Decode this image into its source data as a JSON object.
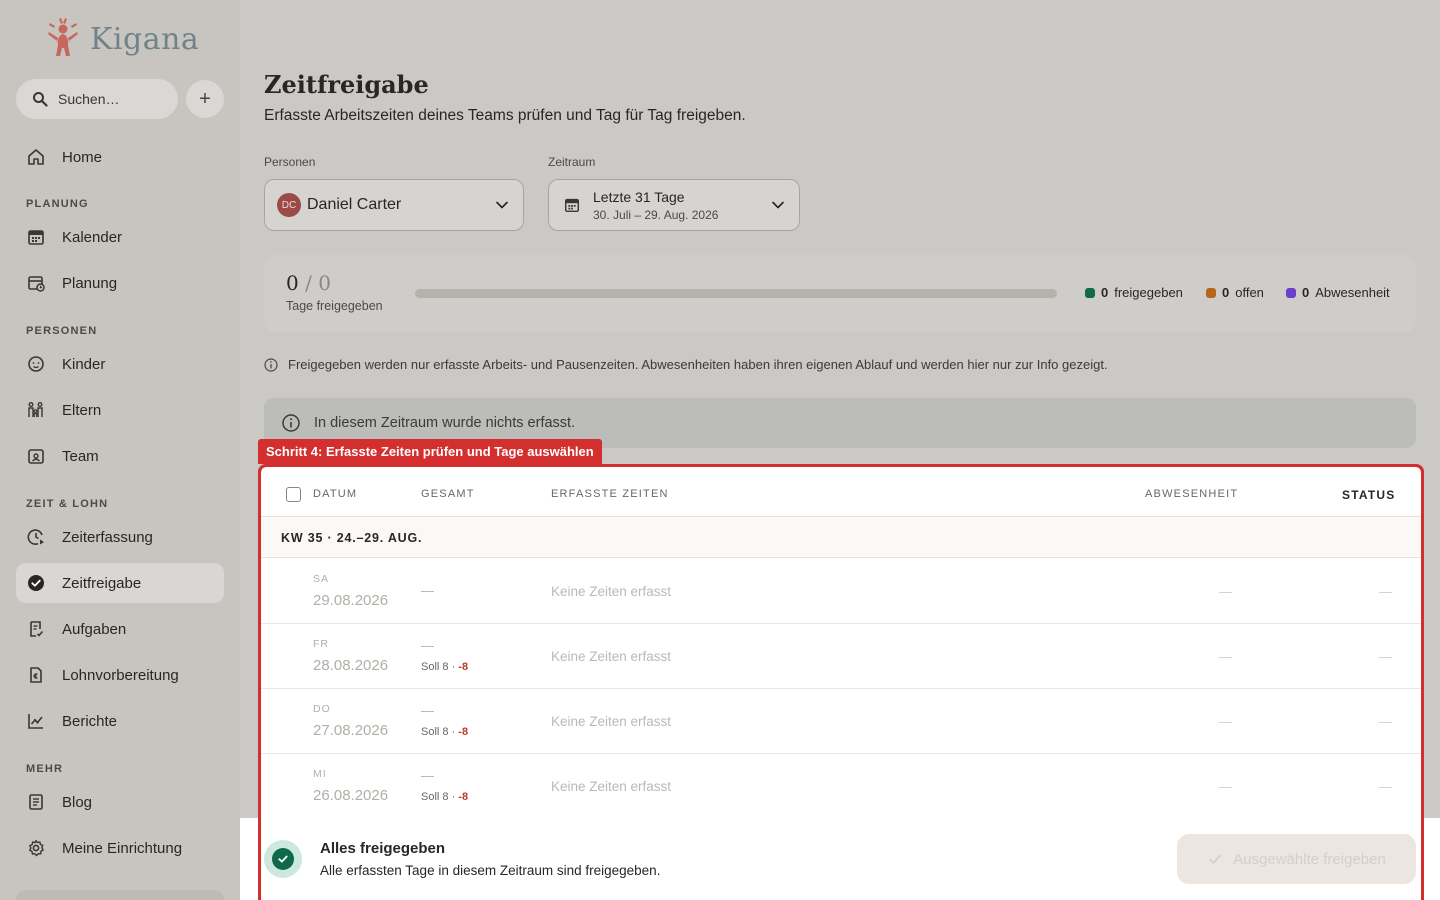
{
  "app": {
    "name": "Kigana"
  },
  "sidebar": {
    "search_placeholder": "Suchen…",
    "add_label": "+",
    "home": "Home",
    "sections": {
      "planung": "PLANUNG",
      "personen": "PERSONEN",
      "zeit": "ZEIT & LOHN",
      "mehr": "MEHR"
    },
    "items": {
      "kalender": "Kalender",
      "planung": "Planung",
      "kinder": "Kinder",
      "eltern": "Eltern",
      "team": "Team",
      "zeiterfassung": "Zeiterfassung",
      "zeitfreigabe": "Zeitfreigabe",
      "aufgaben": "Aufgaben",
      "lohnvorbereitung": "Lohnvorbereitung",
      "berichte": "Berichte",
      "blog": "Blog",
      "einrichtung": "Meine Einrichtung"
    },
    "active": "zeitfreigabe"
  },
  "page": {
    "title": "Zeitfreigabe",
    "subtitle": "Erfasste Arbeitszeiten deines Teams prüfen und Tag für Tag freigeben."
  },
  "filters": {
    "persons_label": "Personen",
    "person_initials": "DC",
    "person_name": "Daniel Carter",
    "range_label": "Zeitraum",
    "range_main": "Letzte 31 Tage",
    "range_sub": "30. Juli – 29. Aug. 2026"
  },
  "progress": {
    "approved": "0",
    "slash": "/",
    "total": "0",
    "label": "Tage freigegeben",
    "fraction": 0,
    "legend": {
      "approved_count": "0",
      "approved_label": "freigegeben",
      "open_count": "0",
      "open_label": "offen",
      "absence_count": "0",
      "absence_label": "Abwesenheit"
    },
    "colors": {
      "approved": "#0f6a4c",
      "open": "#b5651d",
      "absence": "#6a3fc9"
    }
  },
  "info_text": "Freigegeben werden nur erfasste Arbeits- und Pausenzeiten. Abwesenheiten haben ihren eigenen Ablauf und werden hier nur zur Info gezeigt.",
  "empty_notice": "In diesem Zeitraum wurde nichts erfasst.",
  "step_tag": "Schritt 4: Erfasste Zeiten prüfen und Tage auswählen",
  "table": {
    "headers": {
      "datum": "DATUM",
      "gesamt": "GESAMT",
      "erfasste": "ERFASSTE ZEITEN",
      "abwesenheit": "ABWESENHEIT",
      "status": "STATUS"
    },
    "week": "KW 35 · 24.–29. AUG.",
    "rows": [
      {
        "dow": "SA",
        "date": "29.08.2026",
        "gesamt": "—",
        "soll": "",
        "soll_diff": "",
        "times": "Keine Zeiten erfasst",
        "absence": "—",
        "status": "—"
      },
      {
        "dow": "FR",
        "date": "28.08.2026",
        "gesamt": "—",
        "soll": "Soll 8 · ",
        "soll_diff": "-8",
        "times": "Keine Zeiten erfasst",
        "absence": "—",
        "status": "—"
      },
      {
        "dow": "DO",
        "date": "27.08.2026",
        "gesamt": "—",
        "soll": "Soll 8 · ",
        "soll_diff": "-8",
        "times": "Keine Zeiten erfasst",
        "absence": "—",
        "status": "—"
      },
      {
        "dow": "MI",
        "date": "26.08.2026",
        "gesamt": "—",
        "soll": "Soll 8 · ",
        "soll_diff": "-8",
        "times": "Keine Zeiten erfasst",
        "absence": "—",
        "status": "—"
      }
    ]
  },
  "bottom_bar": {
    "title": "Alles freigegeben",
    "subtitle": "Alle erfassten Tage in diesem Zeitraum sind freigegeben.",
    "button": "Ausgewählte freigeben"
  }
}
